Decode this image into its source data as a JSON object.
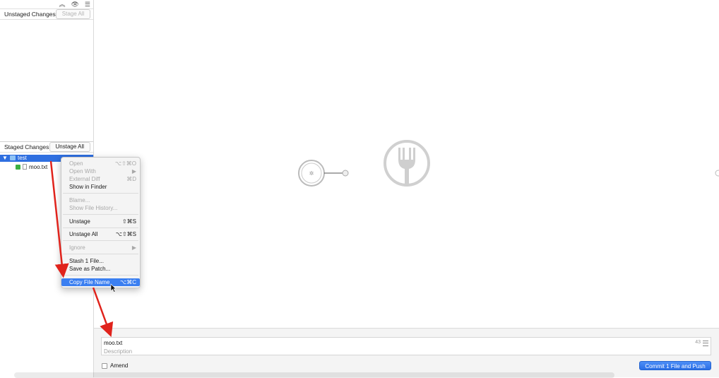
{
  "sidebar": {
    "unstaged": {
      "title": "Unstaged Changes",
      "button": "Stage All"
    },
    "staged": {
      "title": "Staged Changes",
      "button": "Unstage All"
    },
    "tree": {
      "folder": "test",
      "file": "moo.txt"
    }
  },
  "context_menu": {
    "items": [
      {
        "label": "Open",
        "shortcut": "⌥⇧⌘O"
      },
      {
        "label": "Open With",
        "shortcut": "▶"
      },
      {
        "label": "External Diff",
        "shortcut": "⌘D"
      },
      {
        "label": "Show in Finder",
        "shortcut": ""
      },
      {
        "label": "Blame...",
        "shortcut": ""
      },
      {
        "label": "Show File History...",
        "shortcut": ""
      },
      {
        "label": "Unstage",
        "shortcut": "⇧⌘S"
      },
      {
        "label": "Unstage All",
        "shortcut": "⌥⇧⌘S"
      },
      {
        "label": "Ignore",
        "shortcut": "▶"
      },
      {
        "label": "Stash 1 File...",
        "shortcut": ""
      },
      {
        "label": "Save as Patch...",
        "shortcut": ""
      },
      {
        "label": "Copy File Name",
        "shortcut": "⌥⌘C"
      }
    ]
  },
  "commit": {
    "summary_value": "moo.txt",
    "char_count": "43",
    "description_placeholder": "Description",
    "amend_label": "Amend",
    "commit_button": "Commit 1 File and Push"
  },
  "colors": {
    "accent": "#3b7ff1",
    "annotation_arrow": "#e0231c",
    "fork_icon": "#cccccc"
  }
}
